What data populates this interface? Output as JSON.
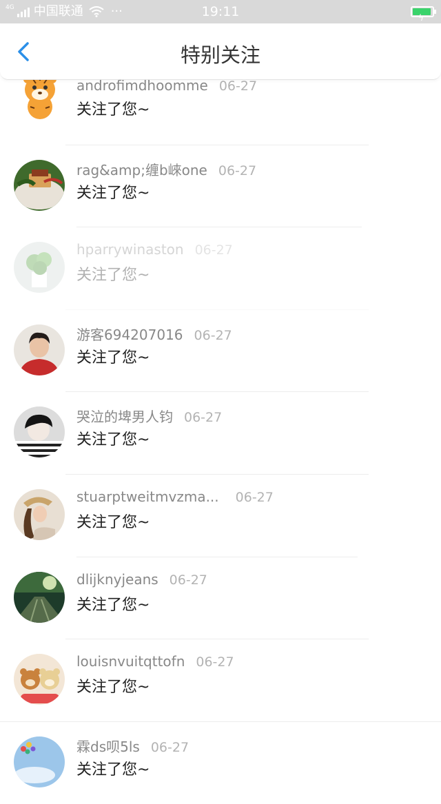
{
  "status_bar": {
    "network": "4G",
    "carrier": "中国联通",
    "more": "···",
    "time": "19:11"
  },
  "nav": {
    "title": "特别关注",
    "back_icon": "chevron-left-icon"
  },
  "notifications": [
    {
      "username": "androfimdhoomme",
      "date": "06-27",
      "message": "关注了您~",
      "avatar": "tiger-cartoon"
    },
    {
      "username": "rag&amp;缠b崍one",
      "date": "06-27",
      "message": "关注了您~",
      "avatar": "food-plate"
    },
    {
      "username": "hparrywinaston",
      "date": "06-27",
      "message": "关注了您~",
      "avatar": "green-plant"
    },
    {
      "username": "游客694207016",
      "date": "06-27",
      "message": "关注了您~",
      "avatar": "boy-red-shirt"
    },
    {
      "username": "哭泣的埤男人钧",
      "date": "06-27",
      "message": "关注了您~",
      "avatar": "boy-striped"
    },
    {
      "username": "stuarptweitmvzma...",
      "date": "06-27",
      "message": "关注了您~",
      "avatar": "girl-hat"
    },
    {
      "username": "dlijknyjeans",
      "date": "06-27",
      "message": "关注了您~",
      "avatar": "dark-street"
    },
    {
      "username": "louisnvuitqttofn",
      "date": "06-27",
      "message": "关注了您~",
      "avatar": "bear-toys"
    },
    {
      "username": "霖ds呗5ls",
      "date": "06-27",
      "message": "关注了您~",
      "avatar": "sky-balloons"
    }
  ],
  "colors": {
    "accent": "#2b8fe8",
    "status_bar_bg": "#d9d9d9",
    "battery": "#3ad36b"
  }
}
